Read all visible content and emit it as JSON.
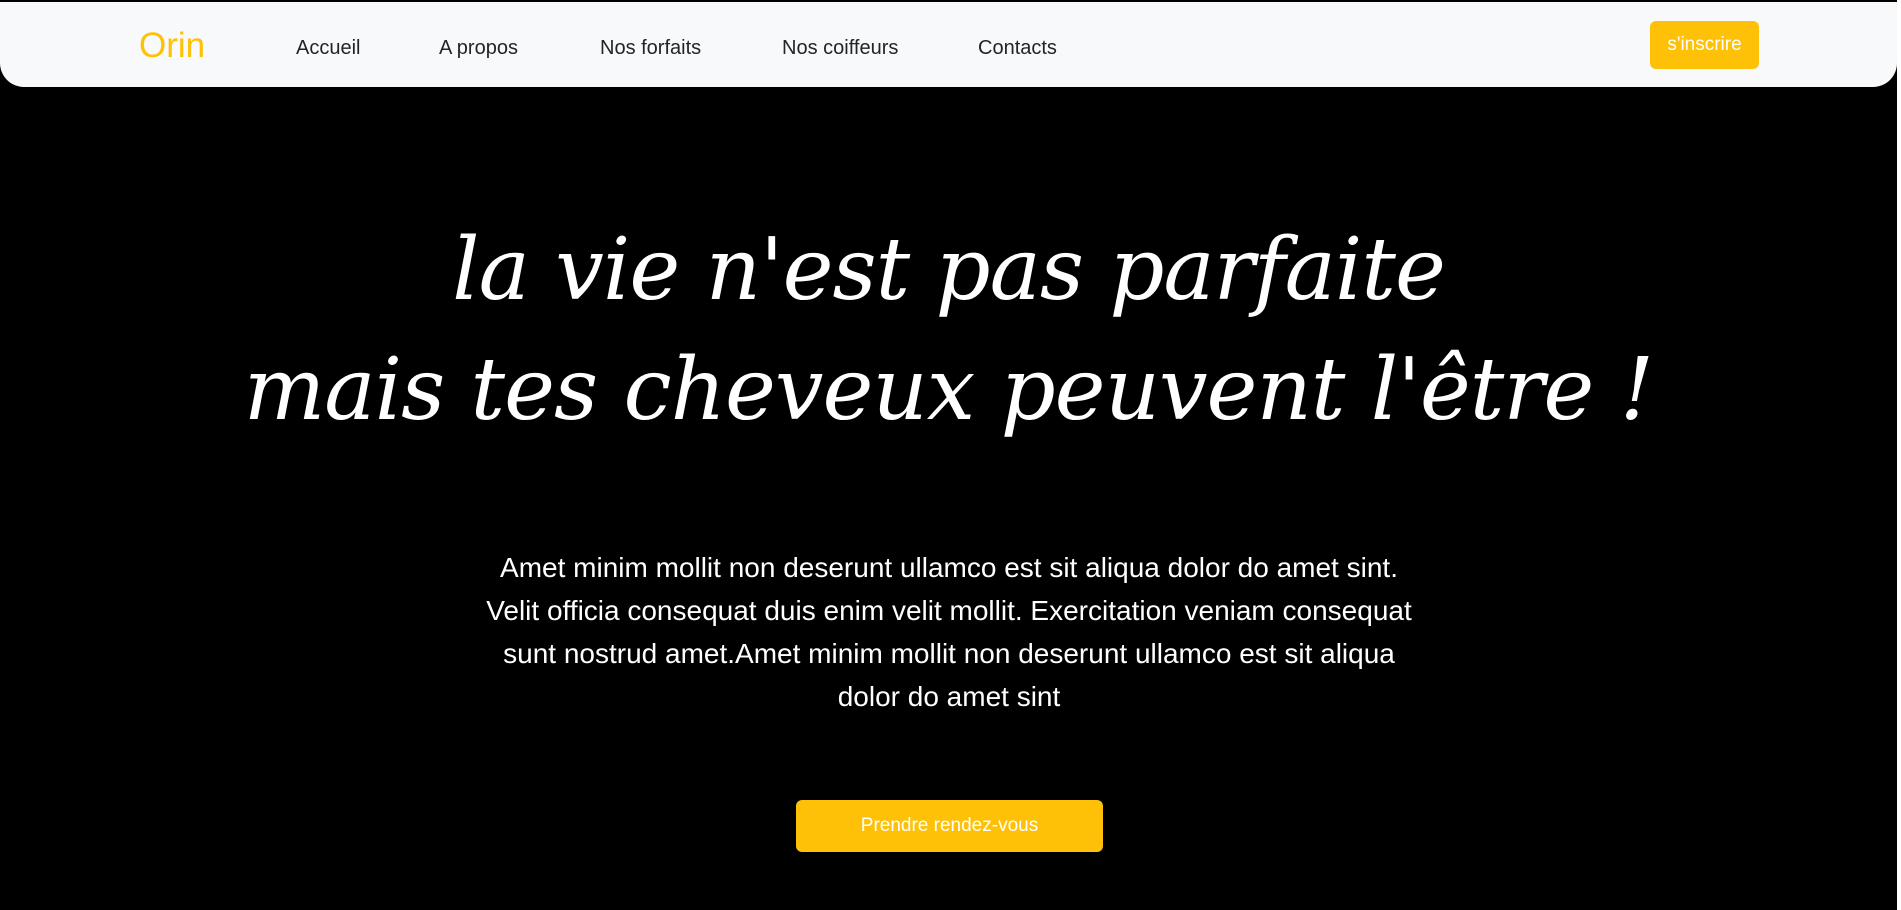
{
  "navbar": {
    "brand": "Orin",
    "links": [
      {
        "label": "Accueil"
      },
      {
        "label": "A propos"
      },
      {
        "label": "Nos forfaits"
      },
      {
        "label": "Nos coiffeurs"
      },
      {
        "label": "Contacts"
      }
    ],
    "signup_label": "s'inscrire"
  },
  "hero": {
    "title_line1": "la vie n'est pas parfaite",
    "title_line2": "mais tes cheveux peuvent l'être !",
    "paragraph": "Amet minim mollit non deserunt ullamco est sit aliqua dolor do amet sint. Velit officia consequat duis enim velit mollit. Exercitation veniam consequat sunt nostrud amet.Amet minim mollit non deserunt ullamco est sit aliqua dolor do amet sint",
    "cta_label": "Prendre rendez-vous"
  },
  "colors": {
    "accent": "#ffc107",
    "background": "#000000",
    "navbar_bg": "#f8f9fa",
    "text_light": "#ffffff",
    "text_dark": "#212529"
  }
}
